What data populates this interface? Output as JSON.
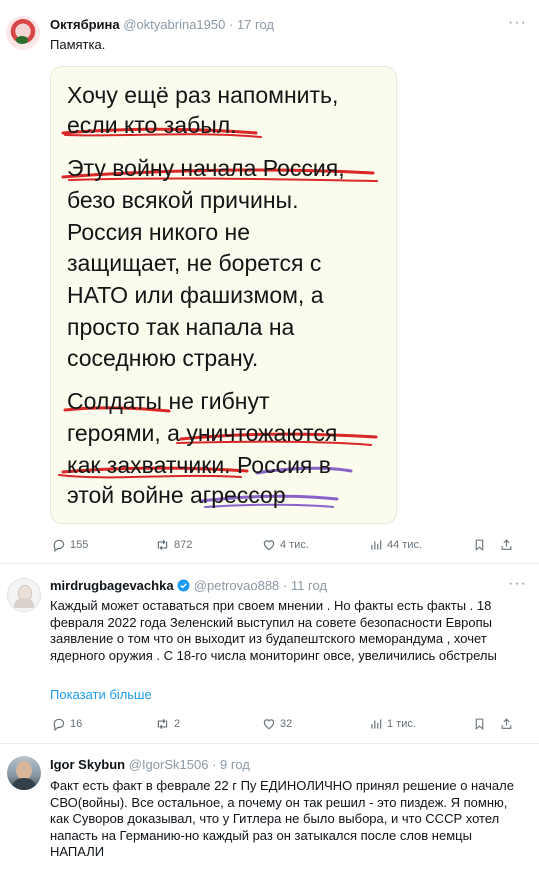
{
  "posts": [
    {
      "name": "Октябрина",
      "handle": "@oktyabrina1950",
      "dot": "·",
      "time": "17 год",
      "more": "···",
      "text": "Памятка.",
      "card_lines": [
        "Хочу ещё раз напомнить,",
        "если кто забыл.",
        "Эту войну начала Россия,",
        "безо всякой причины.",
        "Россия никого не",
        "защищает, не борется с",
        "НАТО или фашизмом, а",
        "просто так напала на",
        "соседнюю страну.",
        "Солдаты не гибнут",
        "героями, а уничтожаются",
        "как захватчики. Россия в",
        "этой войне агрессор"
      ],
      "stats": {
        "replies": "155",
        "reposts": "872",
        "likes": "4 тис.",
        "views": "44 тис."
      }
    },
    {
      "name": "mirdrugbagevachka",
      "verified": true,
      "handle": "@petrovao888",
      "dot": "·",
      "time": "11 год",
      "more": "···",
      "text": "Каждый может оставаться при своем мнении . Но факты есть факты . 18 февраля 2022 года Зеленский выступил на совете безопасности Европы заявление о том что он выходит из будапештского меморандума , хочет ядерного оружия . С 18-го числа мониторинг овсе, увеличились обстрелы",
      "show_more": "Показати більше",
      "stats": {
        "replies": "16",
        "reposts": "2",
        "likes": "32",
        "views": "1 тис."
      }
    },
    {
      "name": "Igor Skybun",
      "handle": "@IgorSk1506",
      "dot": "·",
      "time": "9 год",
      "text": "Факт есть факт в феврале 22 г Пу ЕДИНОЛИЧНО принял решение о начале СВО(войны). Все остальное, а почему он так решил - это пиздеж. Я помню, как Суворов доказывал, что у Гитлера не было выбора, и что СССР хотел напасть на Германию-но каждый раз он затыкался после слов немцы НАПАЛИ"
    }
  ],
  "colors": {
    "muted": "#8b98a5",
    "link": "#1d9bf0",
    "verified": "#1d9bf0",
    "underline_red": "#d92626",
    "underline_purple": "#8a63c9",
    "card_bg": "#fbfbee"
  },
  "icons": [
    "reply-icon",
    "repost-icon",
    "like-icon",
    "views-icon",
    "bookmark-icon",
    "share-icon",
    "verified-icon",
    "more-icon"
  ]
}
